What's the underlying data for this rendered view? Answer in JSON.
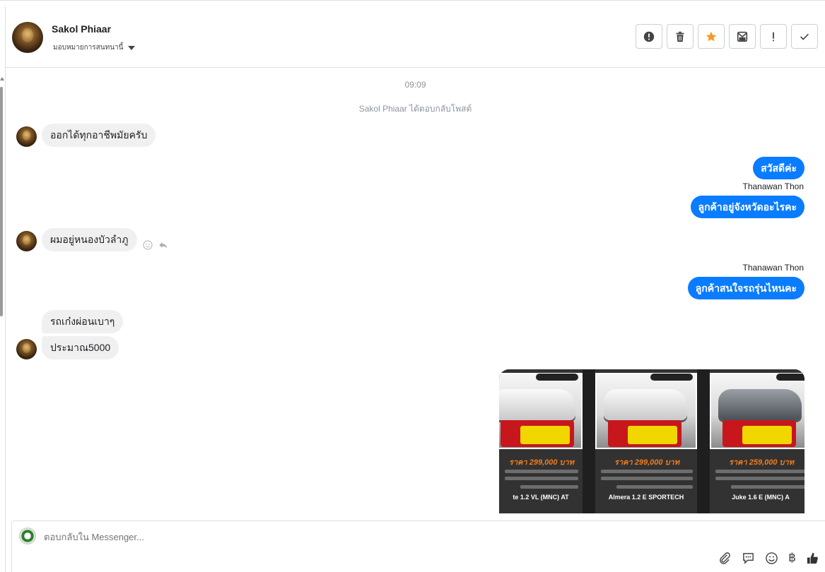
{
  "header": {
    "contact_name": "Sakol Phiaar",
    "assign_label": "มอบหมายการสนทนานี้",
    "toolbar": [
      {
        "name": "alert-icon"
      },
      {
        "name": "trash-icon"
      },
      {
        "name": "star-icon"
      },
      {
        "name": "mark-unread-icon"
      },
      {
        "name": "exclamation-icon"
      },
      {
        "name": "checkmark-icon"
      }
    ]
  },
  "thread": {
    "timestamp": "09:09",
    "system_notice": "Sakol Phiaar ได้ตอบกลับโพสต์",
    "messages": [
      {
        "from": "customer",
        "text": "ออกได้ทุกอาชีพมัยครับ"
      },
      {
        "from": "page",
        "text": "สวัสดีค่ะ"
      },
      {
        "from": "page",
        "sender": "Thanawan Thon",
        "text": "ลูกค้าอยู่จังหวัดอะไรคะ"
      },
      {
        "from": "customer",
        "text": "ผมอยู่หนองบัวลำภู"
      },
      {
        "from": "page",
        "sender": "Thanawan Thon",
        "text": "ลูกค้าสนใจรถรุ่นไหนคะ"
      },
      {
        "from": "customer",
        "text": "รถเก๋งผ่อนเบาๆ"
      },
      {
        "from": "customer",
        "text": "ประมาณ5000"
      }
    ],
    "image_cards": [
      {
        "price": "ราคา 299,000 บาท",
        "model": "te 1.2 VL (MNC) AT",
        "phone": "088-557-7032"
      },
      {
        "price": "ราคา 299,000 บาท",
        "model": "Almera 1.2 E SPORTECH",
        "phone": "088-557-7032"
      },
      {
        "price": "ราคา 259,000 บาท",
        "model": "Juke 1.6 E (MNC) A",
        "phone": "088-557-7032"
      }
    ]
  },
  "composer": {
    "placeholder": "ตอบกลับใน Messenger...",
    "icons": [
      "paperclip-icon",
      "saved-reply-icon",
      "emoji-icon",
      "baht-icon",
      "thumbs-up-icon"
    ],
    "baht_symbol": "฿"
  },
  "colors": {
    "outgoing_bubble": "#0a7cff",
    "incoming_bubble": "#f0f0f0",
    "star_accent": "#f59b23"
  }
}
